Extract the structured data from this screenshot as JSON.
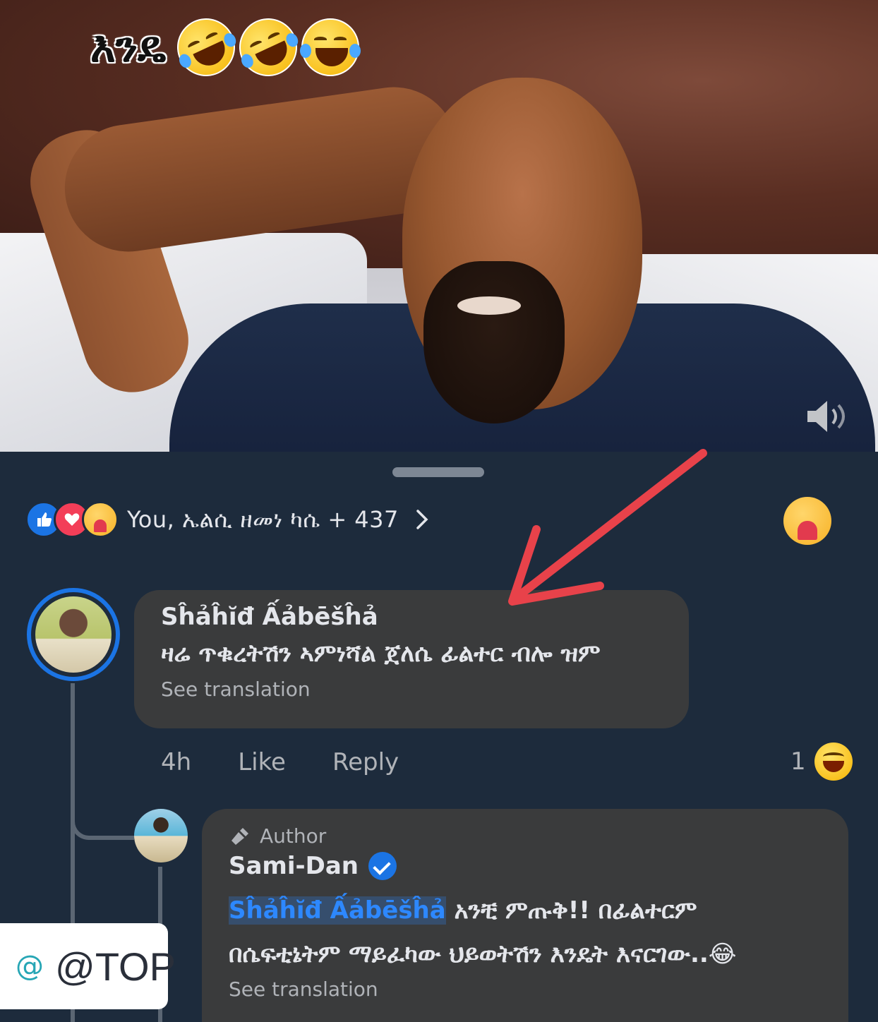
{
  "caption": {
    "text": "እንዴ",
    "emojis": [
      "rolling-on-floor-laughing",
      "rolling-on-floor-laughing",
      "face-with-tears-of-joy"
    ]
  },
  "reactions": {
    "icons": [
      "like-icon",
      "love-icon",
      "care-icon"
    ],
    "summary": "You, ኤልሲ ዘመነ ካሴ + 437"
  },
  "comment": {
    "author": "Sĥảĥĭđ Ấảbēšĥả",
    "text": "ዛሬ ጥቁረትሽን ኣምነሻል ጀለሴ ፊልተር ብሎ ዝም",
    "see_translation": "See translation",
    "time": "4h",
    "like": "Like",
    "reply": "Reply",
    "reaction_count": "1"
  },
  "reply": {
    "badge": "Author",
    "author": "Sami-Dan",
    "mention": "Sĥảĥĭđ Ấảbēšĥả",
    "text_line1": "አንቺ ምጡቅ!! በፊልተርም",
    "text_line2": "በሴፍቲኔትም ማይፈካው ህይወትሽን እንዴት እናርገው..😂",
    "see_translation": "See translation"
  },
  "tag": {
    "at": "@",
    "text": "@TOP"
  },
  "colors": {
    "sheet_bg": "#1d2b3c",
    "bubble_bg": "#3a3b3c",
    "accent_blue": "#1b74e4",
    "annotation_red": "#e8424a"
  }
}
